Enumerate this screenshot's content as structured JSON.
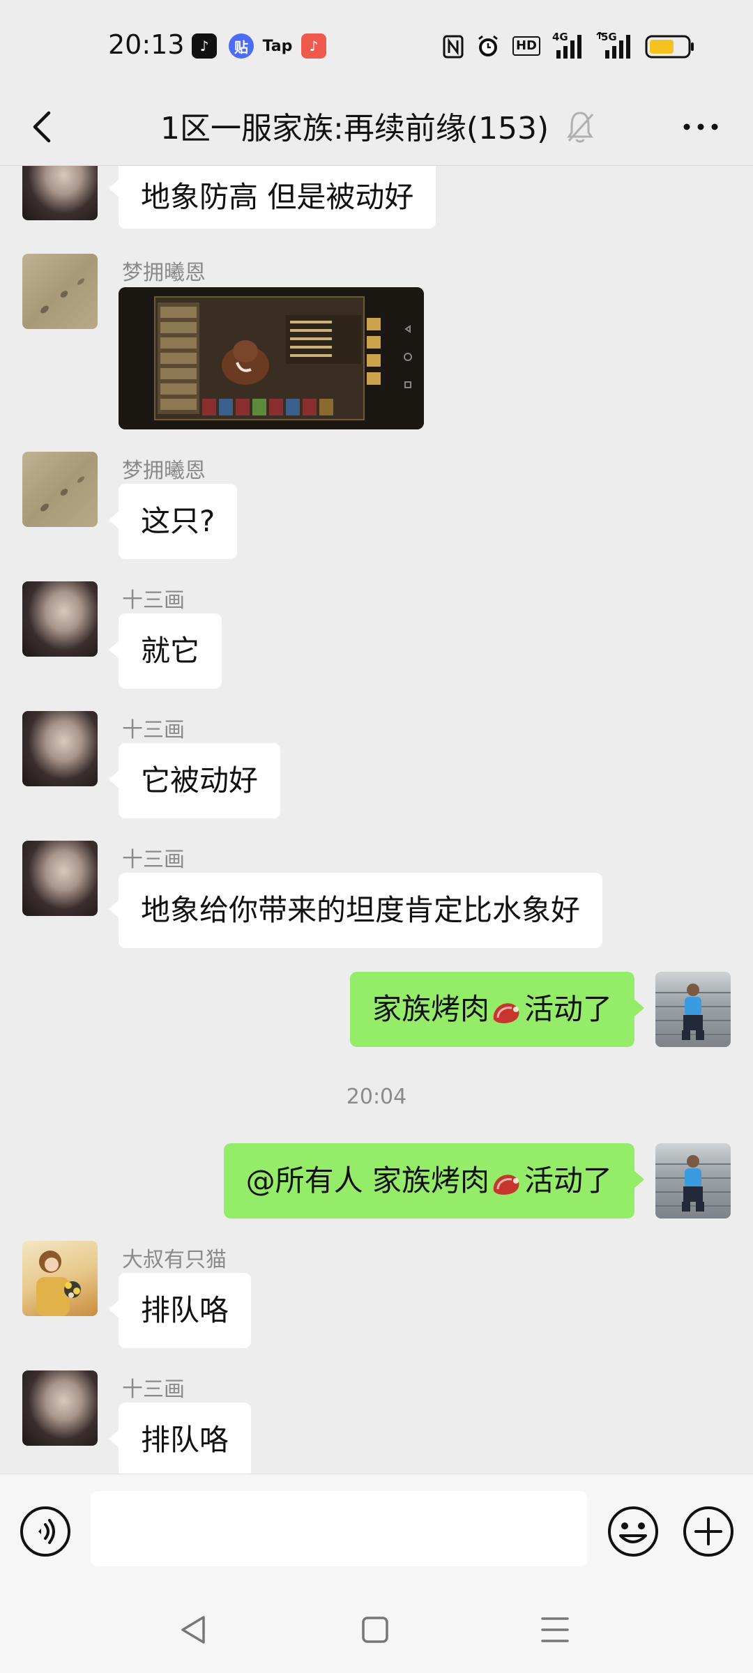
{
  "status_bar": {
    "time": "20:13",
    "apps": [
      {
        "icon": "tiktok-icon",
        "label": "♪",
        "color": "#111111"
      },
      {
        "icon": "tieba-icon",
        "label": "贴",
        "color": "#4a6cf7"
      },
      {
        "icon": "taptap-icon",
        "label": "Tap",
        "color": "#ededed"
      },
      {
        "icon": "music-icon",
        "label": "♪",
        "color": "#f05a4e"
      }
    ],
    "network_labels": {
      "hd": "HD",
      "net1": "4G",
      "net2": "5G"
    }
  },
  "header": {
    "title": "1区一服家族:再续前缘(153)",
    "back_icon": "chevron-left-icon",
    "mute_icon": "bell-off-icon",
    "more_icon": "more-dots-icon"
  },
  "messages": [
    {
      "sender": "",
      "text": "地象防高 但是被动好",
      "side": "left",
      "avatar": "girl"
    },
    {
      "sender": "梦拥曦恩",
      "type": "image",
      "side": "left",
      "avatar": "sand"
    },
    {
      "sender": "梦拥曦恩",
      "text": "这只?",
      "side": "left",
      "avatar": "sand"
    },
    {
      "sender": "十三画",
      "text": "就它",
      "side": "left",
      "avatar": "girl"
    },
    {
      "sender": "十三画",
      "text": "它被动好",
      "side": "left",
      "avatar": "girl"
    },
    {
      "sender": "十三画",
      "text": "地象给你带来的坦度肯定比水象好",
      "side": "left",
      "avatar": "girl"
    },
    {
      "sender": "",
      "text_before": "家族烤肉",
      "text_after": "活动了",
      "emoji": "meat-emoji",
      "side": "right",
      "avatar": "man"
    },
    {
      "sender": "",
      "text_before": "@所有人 家族烤肉",
      "text_after": "活动了",
      "emoji": "meat-emoji",
      "side": "right",
      "avatar": "man"
    },
    {
      "sender": "大叔有只猫",
      "text": "排队咯",
      "side": "left",
      "avatar": "cat"
    },
    {
      "sender": "十三画",
      "text": "排队咯",
      "side": "left",
      "avatar": "girl"
    }
  ],
  "timestamp": "20:04",
  "input_bar": {
    "voice_icon": "voice-icon",
    "emoji_icon": "emoji-icon",
    "plus_icon": "plus-icon",
    "input_value": ""
  },
  "nav_bar": {
    "back_icon": "nav-back-icon",
    "home_icon": "nav-home-icon",
    "menu_icon": "nav-menu-icon"
  },
  "colors": {
    "background": "#ededed",
    "my_bubble": "#95ec69",
    "other_bubble": "#ffffff",
    "meta_text": "#8a8a8a"
  }
}
